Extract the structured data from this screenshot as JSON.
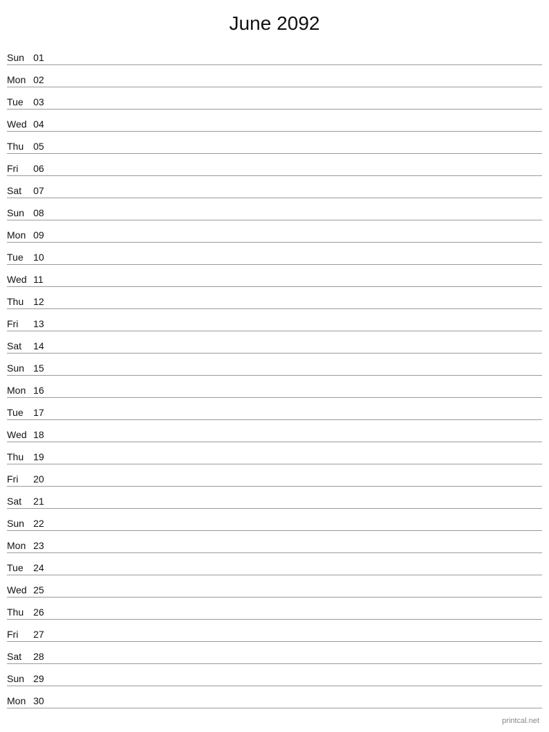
{
  "title": "June 2092",
  "watermark": "printcal.net",
  "days": [
    {
      "name": "Sun",
      "number": "01"
    },
    {
      "name": "Mon",
      "number": "02"
    },
    {
      "name": "Tue",
      "number": "03"
    },
    {
      "name": "Wed",
      "number": "04"
    },
    {
      "name": "Thu",
      "number": "05"
    },
    {
      "name": "Fri",
      "number": "06"
    },
    {
      "name": "Sat",
      "number": "07"
    },
    {
      "name": "Sun",
      "number": "08"
    },
    {
      "name": "Mon",
      "number": "09"
    },
    {
      "name": "Tue",
      "number": "10"
    },
    {
      "name": "Wed",
      "number": "11"
    },
    {
      "name": "Thu",
      "number": "12"
    },
    {
      "name": "Fri",
      "number": "13"
    },
    {
      "name": "Sat",
      "number": "14"
    },
    {
      "name": "Sun",
      "number": "15"
    },
    {
      "name": "Mon",
      "number": "16"
    },
    {
      "name": "Tue",
      "number": "17"
    },
    {
      "name": "Wed",
      "number": "18"
    },
    {
      "name": "Thu",
      "number": "19"
    },
    {
      "name": "Fri",
      "number": "20"
    },
    {
      "name": "Sat",
      "number": "21"
    },
    {
      "name": "Sun",
      "number": "22"
    },
    {
      "name": "Mon",
      "number": "23"
    },
    {
      "name": "Tue",
      "number": "24"
    },
    {
      "name": "Wed",
      "number": "25"
    },
    {
      "name": "Thu",
      "number": "26"
    },
    {
      "name": "Fri",
      "number": "27"
    },
    {
      "name": "Sat",
      "number": "28"
    },
    {
      "name": "Sun",
      "number": "29"
    },
    {
      "name": "Mon",
      "number": "30"
    }
  ]
}
